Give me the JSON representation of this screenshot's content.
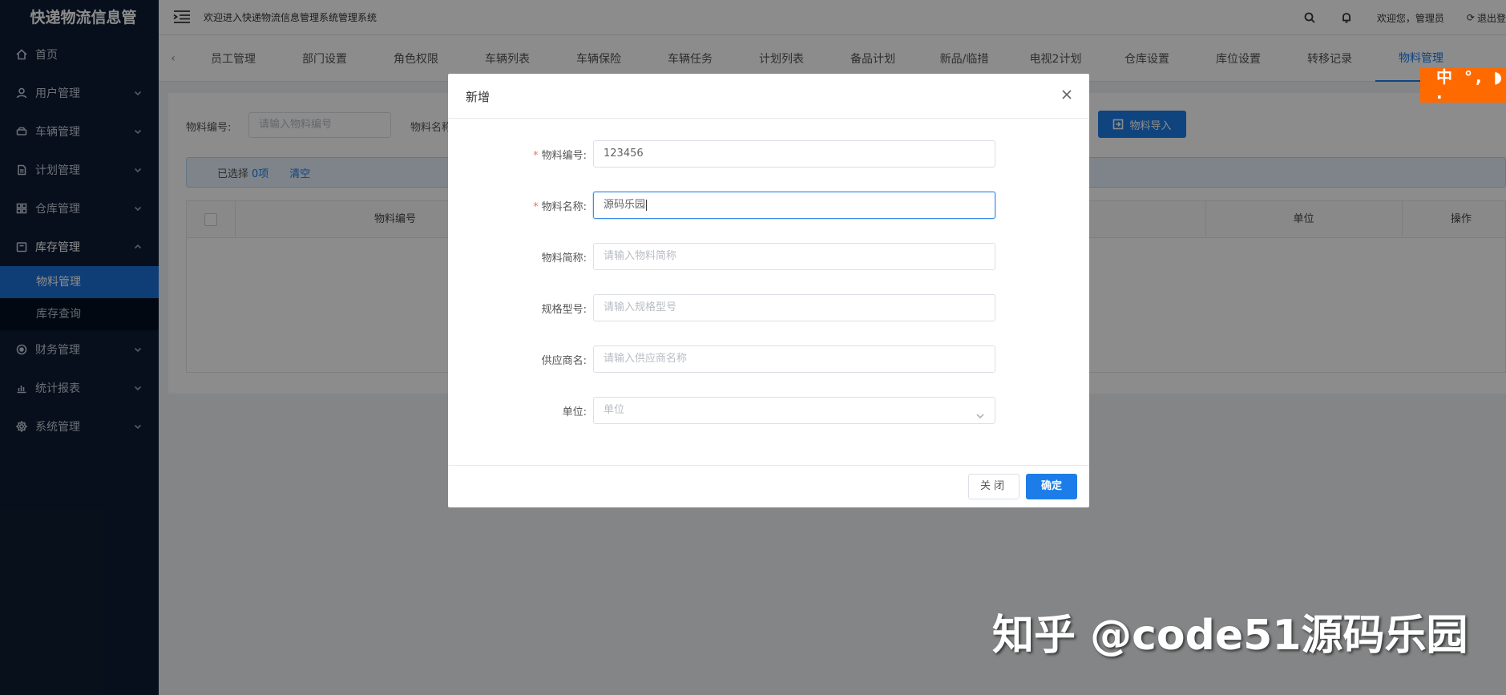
{
  "app": {
    "logo": "快递物流信息管",
    "welcome": "欢迎进入快递物流信息管理系统管理系统",
    "user_greeting": "欢迎您，管理员",
    "logout": "退出登"
  },
  "sidebar": {
    "items": [
      {
        "label": "首页",
        "icon": "home-icon"
      },
      {
        "label": "用户管理",
        "icon": "user-icon"
      },
      {
        "label": "车辆管理",
        "icon": "car-icon"
      },
      {
        "label": "计划管理",
        "icon": "document-icon"
      },
      {
        "label": "仓库管理",
        "icon": "grid-icon"
      },
      {
        "label": "库存管理",
        "icon": "inventory-icon"
      },
      {
        "label": "财务管理",
        "icon": "finance-icon"
      },
      {
        "label": "统计报表",
        "icon": "chart-icon"
      },
      {
        "label": "系统管理",
        "icon": "settings-icon"
      }
    ],
    "sub_items": [
      {
        "label": "物料管理",
        "active": true
      },
      {
        "label": "库存查询",
        "active": false
      }
    ]
  },
  "tabs": [
    "员工管理",
    "部门设置",
    "角色权限",
    "车辆列表",
    "车辆保险",
    "车辆任务",
    "计划列表",
    "备品计划",
    "新品/临措",
    "电视2计划",
    "仓库设置",
    "库位设置",
    "转移记录",
    "物料管理"
  ],
  "filter": {
    "code_label": "物料编号:",
    "code_placeholder": "请输入物料编号",
    "name_label": "物料名称",
    "import_label": "物料导入"
  },
  "selection": {
    "prefix": "已选择",
    "count": "0项",
    "clear": "清空"
  },
  "table": {
    "headers": [
      "物料编号",
      "单位",
      "操作"
    ]
  },
  "ime": "中 °, ◗ ·",
  "dialog": {
    "title": "新增",
    "fields": [
      {
        "label": "物料编号:",
        "required": true,
        "value": "123456",
        "placeholder": ""
      },
      {
        "label": "物料名称:",
        "required": true,
        "value": "源码乐园",
        "placeholder": ""
      },
      {
        "label": "物料简称:",
        "required": false,
        "value": "",
        "placeholder": "请输入物料简称"
      },
      {
        "label": "规格型号:",
        "required": false,
        "value": "",
        "placeholder": "请输入规格型号"
      },
      {
        "label": "供应商名:",
        "required": false,
        "value": "",
        "placeholder": "请输入供应商名称"
      },
      {
        "label": "单位:",
        "required": false,
        "value": "",
        "placeholder": "单位"
      }
    ],
    "close_label": "关闭",
    "ok_label": "确定"
  },
  "watermark": "知乎 @code51源码乐园",
  "colors": {
    "sidebar_bg": "#0e1d33",
    "accent": "#1c7de8",
    "ime_orange": "#ff6a00"
  }
}
